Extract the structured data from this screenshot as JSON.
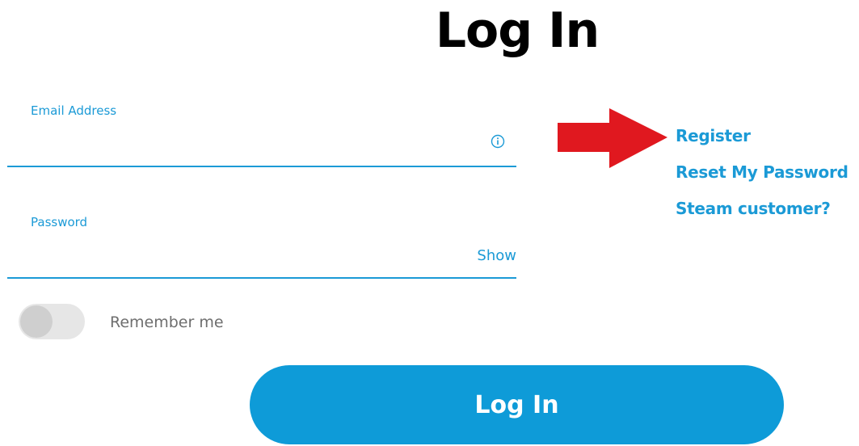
{
  "page": {
    "title": "Log In"
  },
  "form": {
    "email": {
      "label": "Email Address",
      "value": "",
      "info_icon": "info-circle-icon"
    },
    "password": {
      "label": "Password",
      "value": "",
      "show_label": "Show"
    },
    "remember": {
      "label": "Remember me",
      "checked": false
    },
    "submit_label": "Log In"
  },
  "side_links": {
    "register": "Register",
    "reset_password": "Reset My Password",
    "steam_customer": "Steam customer?"
  },
  "annotation": {
    "arrow_icon": "red-arrow-right-icon",
    "arrow_color": "#e0181f"
  },
  "colors": {
    "accent": "#1b9ad6",
    "button": "#0e9bd8"
  }
}
